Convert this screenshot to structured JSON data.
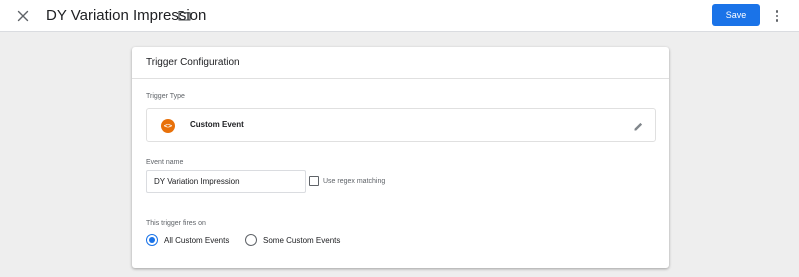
{
  "header": {
    "title": "DY Variation Impression",
    "close_icon": "close-icon",
    "folder_icon": "folder-icon",
    "save_label": "Save",
    "more_icon": "more-vert-icon"
  },
  "card": {
    "title": "Trigger Configuration",
    "trigger_type": {
      "label": "Trigger Type",
      "name": "Custom Event",
      "icon": "custom-event-icon",
      "icon_glyph": "<>",
      "icon_color": "#e8710a"
    },
    "event_name": {
      "label": "Event name",
      "value": "DY Variation Impression",
      "regex_label": "Use regex matching",
      "regex_checked": false
    },
    "fires_on": {
      "label": "This trigger fires on",
      "options": [
        {
          "label": "All Custom Events",
          "selected": true
        },
        {
          "label": "Some Custom Events",
          "selected": false
        }
      ]
    }
  },
  "colors": {
    "accent": "#1a73e8",
    "background": "#eeeeee"
  }
}
